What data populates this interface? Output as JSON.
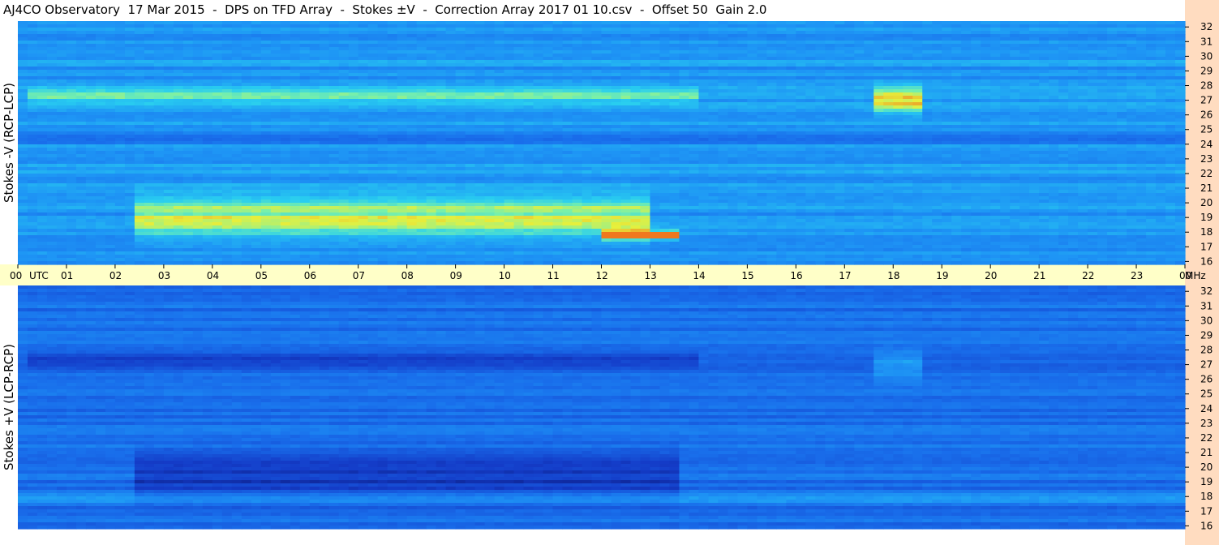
{
  "title": "AJ4CO Observatory  17 Mar 2015  -  DPS on TFD Array  -  Stokes ±V  -  Correction Array 2017 01 10.csv  -  Offset 50  Gain 2.0",
  "colors": {
    "time_axis_band": "#ffffc8",
    "freq_axis_band": "#ffdcc0",
    "background": "#ffffff"
  },
  "chart_data": [
    {
      "type": "heatmap",
      "ylabel": "Stokes -V (RCP-LCP)",
      "xlim": [
        0,
        24
      ],
      "ylim": [
        15.8,
        32.4
      ],
      "x_ticks": [
        "00",
        "01",
        "02",
        "03",
        "04",
        "05",
        "06",
        "07",
        "08",
        "09",
        "10",
        "11",
        "12",
        "13",
        "14",
        "15",
        "16",
        "17",
        "18",
        "19",
        "20",
        "21",
        "22",
        "23",
        "00"
      ],
      "x_unit": "UTC",
      "y_ticks": [
        "16",
        "17",
        "18",
        "19",
        "20",
        "21",
        "22",
        "23",
        "24",
        "25",
        "26",
        "27",
        "28",
        "29",
        "30",
        "31",
        "32"
      ],
      "y_unit": "MHz",
      "base_level": 0.55,
      "features": [
        {
          "t0": 2.5,
          "t1": 13.0,
          "f": 19.0,
          "w": 1.4,
          "amp": 0.32,
          "desc": "bright band"
        },
        {
          "t0": 0.3,
          "t1": 14.0,
          "f": 27.3,
          "w": 0.5,
          "amp": 0.22,
          "desc": "band"
        },
        {
          "t0": 12.0,
          "t1": 13.5,
          "f": 17.8,
          "w": 0.3,
          "amp": 0.6,
          "desc": "hot streak"
        },
        {
          "t0": 17.7,
          "t1": 18.6,
          "f": 27.0,
          "w": 0.9,
          "amp": 0.35,
          "desc": "patch"
        },
        {
          "t0": 0.0,
          "t1": 24.0,
          "f": 24.5,
          "w": 0.5,
          "amp": -0.12,
          "desc": "dark band"
        }
      ]
    },
    {
      "type": "heatmap",
      "ylabel": "Stokes +V (LCP-RCP)",
      "xlim": [
        0,
        24
      ],
      "ylim": [
        15.8,
        32.4
      ],
      "x_ticks": [
        "00",
        "01",
        "02",
        "03",
        "04",
        "05",
        "06",
        "07",
        "08",
        "09",
        "10",
        "11",
        "12",
        "13",
        "14",
        "15",
        "16",
        "17",
        "18",
        "19",
        "20",
        "21",
        "22",
        "23",
        "00"
      ],
      "x_unit": "UTC",
      "y_ticks": [
        "16",
        "17",
        "18",
        "19",
        "20",
        "21",
        "22",
        "23",
        "24",
        "25",
        "26",
        "27",
        "28",
        "29",
        "30",
        "31",
        "32"
      ],
      "y_unit": "MHz",
      "base_level": 0.4,
      "features": [
        {
          "t0": 2.5,
          "t1": 13.5,
          "f": 19.5,
          "w": 1.5,
          "amp": -0.22,
          "desc": "dark band"
        },
        {
          "t0": 0.3,
          "t1": 14.0,
          "f": 27.3,
          "w": 0.5,
          "amp": -0.15,
          "desc": "dark band"
        },
        {
          "t0": 0.0,
          "t1": 24.0,
          "f": 17.8,
          "w": 0.25,
          "amp": 0.25,
          "desc": "streak"
        },
        {
          "t0": 17.7,
          "t1": 18.6,
          "f": 27.0,
          "w": 0.9,
          "amp": 0.2,
          "desc": "patch"
        }
      ]
    }
  ]
}
